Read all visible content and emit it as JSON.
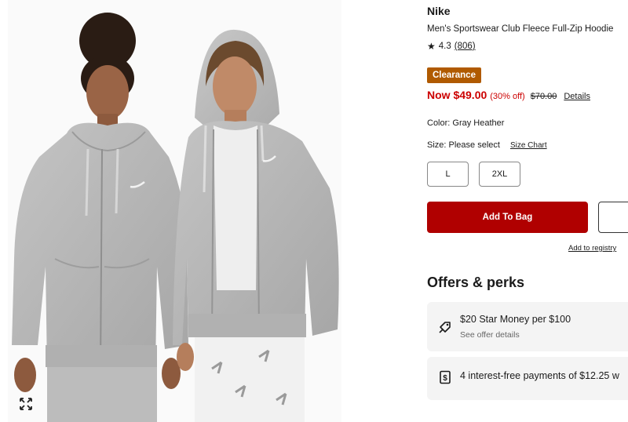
{
  "product": {
    "brand": "Nike",
    "title": "Men's Sportswear Club Fleece Full-Zip Hoodie",
    "rating": "4.3",
    "review_count": "(806)"
  },
  "pricing": {
    "badge": "Clearance",
    "now": "Now $49.00",
    "discount": "(30% off)",
    "regular": "$70.00",
    "details_link": "Details"
  },
  "color": {
    "label": "Color: Gray Heather"
  },
  "size": {
    "label": "Size: Please select",
    "chart_link": "Size Chart",
    "options": [
      "L",
      "2XL"
    ]
  },
  "actions": {
    "add_to_bag": "Add To Bag",
    "registry_link": "Add to registry"
  },
  "offers": {
    "heading": "Offers & perks",
    "items": [
      {
        "title": "$20 Star Money per $100",
        "subtitle": "See offer details",
        "icon": "tag-icon"
      },
      {
        "title": "4 interest-free payments of $12.25 w",
        "icon": "dollar-doc-icon"
      }
    ]
  },
  "image": {
    "expand_icon": "expand-icon"
  },
  "colors": {
    "clearance": "#b05a00",
    "sale_red": "#cc0000",
    "primary_button": "#b00000",
    "card_bg": "#f4f4f4"
  }
}
